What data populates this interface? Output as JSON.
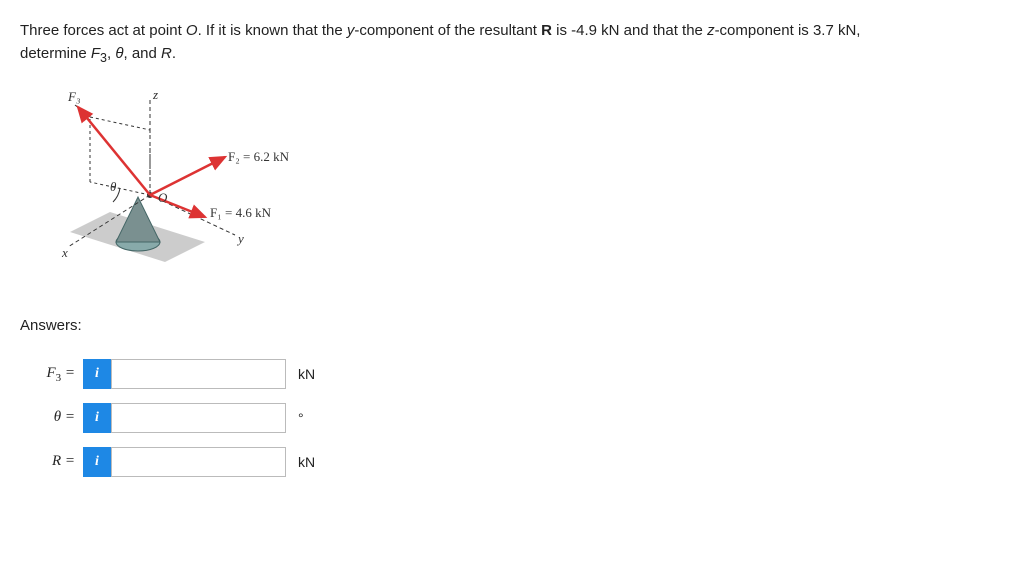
{
  "question": {
    "line1": "Three forces act at point O. If it is known that the y-component of the resultant R is -4.9 kN and that the z-component is 3.7 kN,",
    "line2_prefix": "determine ",
    "line2_vars": "F₃, θ, and R.",
    "O_italic": "O",
    "R_italic": "R",
    "y_italic": "y",
    "z_italic": "z"
  },
  "diagram": {
    "F2_label": "F₂ = 6.2 kN",
    "F1_label": "F₁ = 4.6 kN",
    "F3_label": "F₃",
    "z_label": "z",
    "x_label": "x",
    "y_label": "y",
    "O_label": "O",
    "theta_label": "θ"
  },
  "answers": {
    "heading": "Answers:",
    "rows": [
      {
        "var": "F",
        "sub": "3",
        "eq": " =",
        "info": "i",
        "value": "",
        "unit": "kN"
      },
      {
        "var": "θ",
        "sub": "",
        "eq": " =",
        "info": "i",
        "value": "",
        "unit": "°"
      },
      {
        "var": "R",
        "sub": "",
        "eq": " =",
        "info": "i",
        "value": "",
        "unit": "kN"
      }
    ]
  }
}
